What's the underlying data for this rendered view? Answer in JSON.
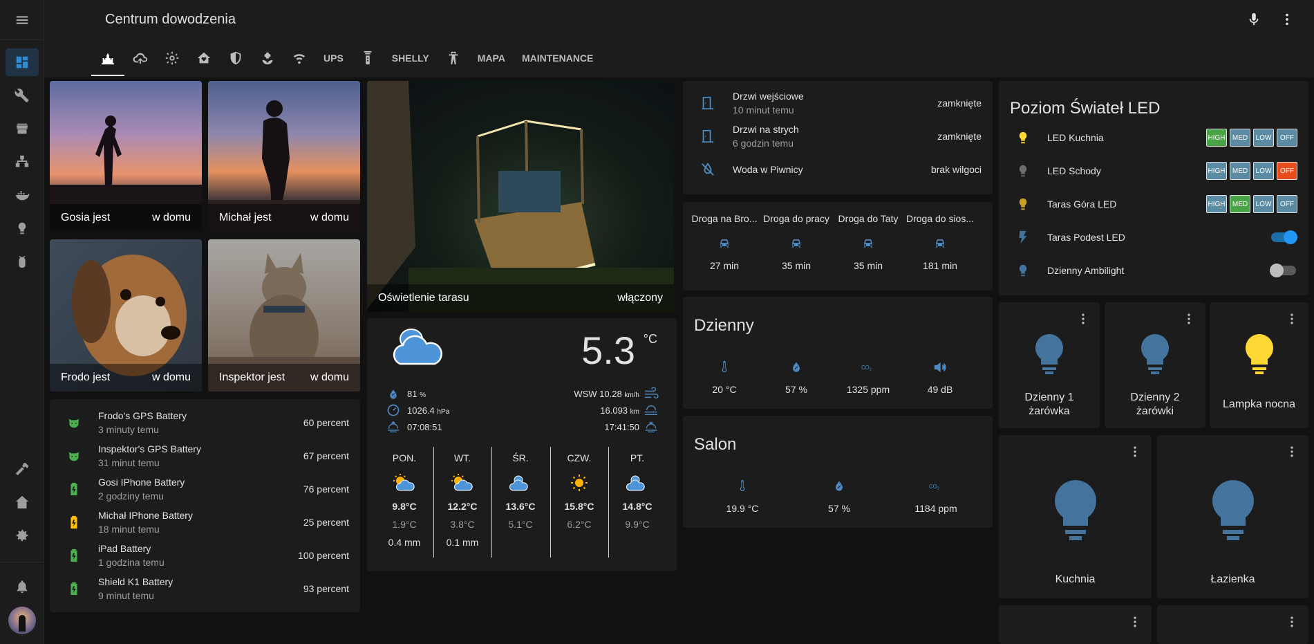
{
  "app": {
    "title": "Centrum dowodzenia"
  },
  "tabs": [
    "UPS",
    "SHELLY",
    "MAPA",
    "MAINTENANCE"
  ],
  "people": [
    {
      "label": "Gosia jest",
      "state": "w domu"
    },
    {
      "label": "Michał jest",
      "state": "w domu"
    },
    {
      "label": "Frodo jest",
      "state": "w domu"
    },
    {
      "label": "Inspektor jest",
      "state": "w domu"
    }
  ],
  "batteries": [
    {
      "name": "Frodo's GPS Battery",
      "time": "3 minuty temu",
      "value": "60 percent",
      "color": "#4caf50"
    },
    {
      "name": "Inspektor's GPS Battery",
      "time": "31 minut temu",
      "value": "67 percent",
      "color": "#4caf50"
    },
    {
      "name": "Gosi IPhone Battery",
      "time": "2 godziny temu",
      "value": "76 percent",
      "color": "#4caf50"
    },
    {
      "name": "Michał IPhone Battery",
      "time": "18 minut temu",
      "value": "25 percent",
      "color": "#ffc107"
    },
    {
      "name": "iPad Battery",
      "time": "1 godzina temu",
      "value": "100 percent",
      "color": "#4caf50"
    },
    {
      "name": "Shield K1 Battery",
      "time": "9 minut temu",
      "value": "93 percent",
      "color": "#4caf50"
    }
  ],
  "terrace": {
    "label": "Oświetlenie tarasu",
    "state": "włączony"
  },
  "weather": {
    "temp": "5.3",
    "unit": "°C",
    "humidity": "81",
    "humidity_unit": "%",
    "pressure": "1026.4",
    "pressure_unit": "hPa",
    "sunrise": "07:08:51",
    "wind": "WSW 10.28",
    "wind_unit": "km/h",
    "visibility": "16.093",
    "visibility_unit": "km",
    "sunset": "17:41:50",
    "forecast": [
      {
        "day": "PON.",
        "hi": "9.8°C",
        "lo": "1.9°C",
        "precip": "0.4 mm",
        "icon": "partly-sunny"
      },
      {
        "day": "WT.",
        "hi": "12.2°C",
        "lo": "3.8°C",
        "precip": "0.1 mm",
        "icon": "partly-sunny"
      },
      {
        "day": "ŚR.",
        "hi": "13.6°C",
        "lo": "5.1°C",
        "precip": "",
        "icon": "cloudy"
      },
      {
        "day": "CZW.",
        "hi": "15.8°C",
        "lo": "6.2°C",
        "precip": "",
        "icon": "sunny"
      },
      {
        "day": "PT.",
        "hi": "14.8°C",
        "lo": "9.9°C",
        "precip": "",
        "icon": "cloudy"
      }
    ]
  },
  "doors": [
    {
      "name": "Drzwi wejściowe",
      "time": "10 minut temu",
      "state": "zamknięte"
    },
    {
      "name": "Drzwi na strych",
      "time": "6 godzin temu",
      "state": "zamknięte"
    },
    {
      "name": "Woda w Piwnicy",
      "time": "",
      "state": "brak wilgoci"
    }
  ],
  "routes": [
    {
      "name": "Droga na Bro...",
      "value": "27 min"
    },
    {
      "name": "Droga do pracy",
      "value": "35 min"
    },
    {
      "name": "Droga do Taty",
      "value": "35 min"
    },
    {
      "name": "Droga do sios...",
      "value": "181 min"
    }
  ],
  "dzienny": {
    "title": "Dzienny",
    "values": [
      "20 °C",
      "57 %",
      "1325 ppm",
      "49 dB"
    ]
  },
  "salon": {
    "title": "Salon",
    "values": [
      "19.9 °C",
      "57 %",
      "1184 ppm"
    ]
  },
  "led": {
    "title": "Poziom Świateł LED",
    "buttons": [
      "HIGH",
      "MED",
      "LOW",
      "OFF"
    ],
    "rows": [
      {
        "name": "LED Kuchnia",
        "active": "HIGH",
        "icon_color": "#fdd835"
      },
      {
        "name": "LED Schody",
        "active": "OFF",
        "icon_color": "#6d6d6d"
      },
      {
        "name": "Taras Góra LED",
        "active": "MED",
        "icon_color": "#c9a227"
      }
    ],
    "toggles": [
      {
        "name": "Taras Podest LED",
        "on": true
      },
      {
        "name": "Dzienny Ambilight",
        "on": false
      }
    ]
  },
  "lights": [
    {
      "name": "Dzienny 1 żarówka",
      "color": "#44739e"
    },
    {
      "name": "Dzienny 2 żarówki",
      "color": "#44739e"
    },
    {
      "name": "Lampka nocna",
      "color": "#fdd835"
    },
    {
      "name": "Kuchnia",
      "color": "#44739e"
    },
    {
      "name": "Łazienka",
      "color": "#44739e"
    }
  ]
}
